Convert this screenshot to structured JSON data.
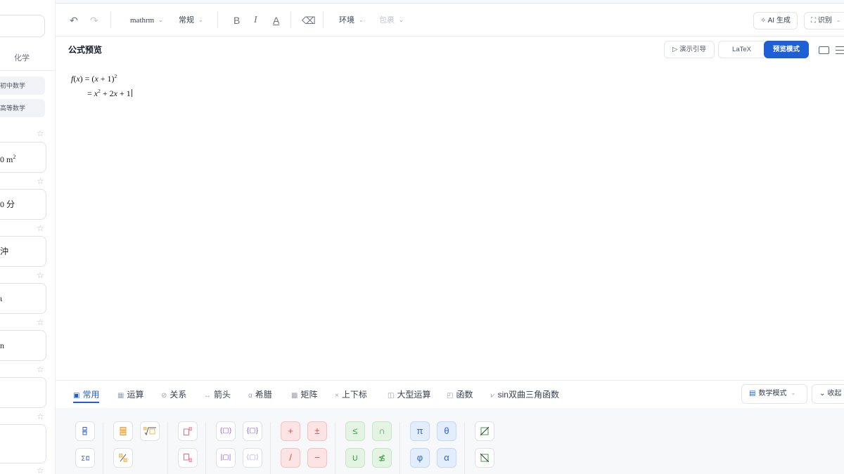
{
  "sidebar": {
    "tab_label": "化学",
    "chips": [
      "初中数学",
      "高等数学"
    ],
    "cards": [
      {
        "text": "0 m",
        "sup": "2"
      },
      {
        "text": "0 分",
        "sup": ""
      },
      {
        "text": "沖",
        "sup": ""
      },
      {
        "text": "ι",
        "sup": ""
      },
      {
        "text": "n",
        "sup": ""
      },
      {
        "text": "",
        "sup": ""
      },
      {
        "text": "",
        "sup": ""
      }
    ],
    "star_icon": "☆"
  },
  "toolbar": {
    "undo_icon": "↶",
    "redo_icon": "↷",
    "font_value": "mathrm",
    "style_value": "常规",
    "bold_icon": "B",
    "italic_icon": "I",
    "color_icon": "A",
    "eraser_icon": "⌫",
    "env_label": "环境",
    "wrap_label": "包裹",
    "ai_label": "AI 生成",
    "ocr_label": "识别",
    "caret": "⌄"
  },
  "preview": {
    "title": "公式预览",
    "demo_label": "演示引导",
    "latex_label": "LaTeX",
    "preview_mode_label": "预览模式",
    "formula": {
      "f": "f",
      "x": "x",
      "line1_mid": ") = (",
      "line1_plus": " + 1)",
      "sup2": "2",
      "line2_eq": "= ",
      "line2_rest_a": " + 2",
      "line2_rest_b": " + 1"
    }
  },
  "symbol_tabs": {
    "tabs": [
      {
        "icon": "▣",
        "label": "常用"
      },
      {
        "icon": "▦",
        "label": "运算"
      },
      {
        "icon": "⊘",
        "label": "关系"
      },
      {
        "icon": "↔",
        "label": "箭头"
      },
      {
        "icon": "α",
        "label": "希腊"
      },
      {
        "icon": "▩",
        "label": "矩阵"
      },
      {
        "icon": "×",
        "label": "上下标"
      },
      {
        "icon": "◫",
        "label": "大型运算"
      },
      {
        "icon": "◰",
        "label": "函数"
      },
      {
        "icon": "⩗",
        "label": "sin双曲三角函数"
      }
    ],
    "mode_label": "数学模式",
    "mode_icon": "▤",
    "collapse_label": "收起"
  },
  "palette": {
    "operators": [
      "+",
      "±",
      "/",
      "−"
    ],
    "relations": [
      "≤",
      "∩",
      "∪",
      "≴"
    ],
    "greek": [
      "π",
      "θ",
      "φ",
      "α"
    ]
  },
  "colors": {
    "primary": "#1f5fd6",
    "red_key": "#e04848",
    "green_key": "#3f9e4a",
    "blue_key": "#2c65d1",
    "orange_glyph": "#e9a23b",
    "pink_glyph": "#e0708a"
  }
}
